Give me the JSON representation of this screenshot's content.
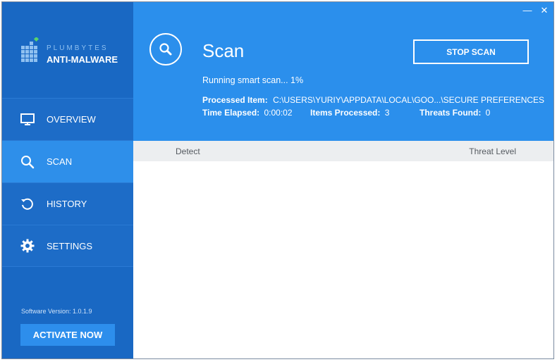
{
  "window": {
    "minimize": "—",
    "close": "✕"
  },
  "logo": {
    "brand": "PLUMBYTES",
    "product": "ANTI-MALWARE"
  },
  "sidebar": {
    "items": [
      {
        "label": "OVERVIEW",
        "icon": "monitor-icon"
      },
      {
        "label": "SCAN",
        "icon": "search-icon"
      },
      {
        "label": "HISTORY",
        "icon": "history-icon"
      },
      {
        "label": "SETTINGS",
        "icon": "gear-icon"
      }
    ],
    "active": "SCAN",
    "version": "Software Version:  1.0.1.9",
    "activate_label": "ACTIVATE NOW"
  },
  "header": {
    "title": "Scan",
    "stop_label": "STOP SCAN",
    "status": "Running smart scan... 1%",
    "processed_item_label": "Processed Item:",
    "processed_item_value": "C:\\USERS\\YURIY\\APPDATA\\LOCAL\\GOO...\\SECURE PREFERENCES",
    "time_elapsed_label": "Time Elapsed:",
    "time_elapsed_value": "0:00:02",
    "items_processed_label": "Items Processed:",
    "items_processed_value": "3",
    "threats_found_label": "Threats Found:",
    "threats_found_value": "0"
  },
  "table": {
    "columns": [
      "Detect",
      "Threat Level"
    ],
    "rows": []
  },
  "colors": {
    "sidebar": "#1968c3",
    "header": "#2b8fec",
    "active_item": "#2e8fea",
    "activate_button": "#2d8eec"
  }
}
